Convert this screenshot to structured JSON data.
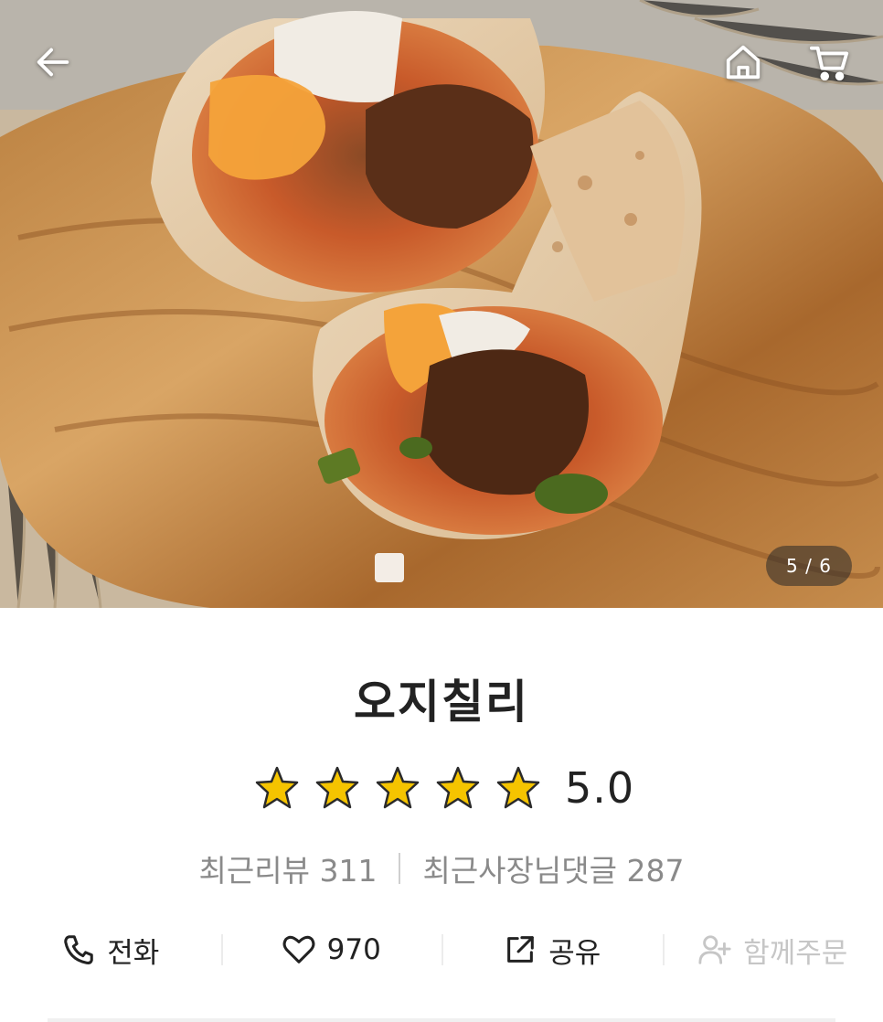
{
  "hero": {
    "image_alt": "오지칠리",
    "page_counter": "5 / 6"
  },
  "topbar": {
    "icons": [
      "back-arrow-icon",
      "home-icon",
      "cart-icon"
    ]
  },
  "store": {
    "name": "오지칠리",
    "rating": {
      "stars": 5,
      "max_stars": 5,
      "value": "5.0",
      "star_color": "#f5c400"
    },
    "reviews": {
      "recent_reviews_label": "최근리뷰 311",
      "owner_replies_label": "최근사장님댓글 287"
    }
  },
  "actions": {
    "call": {
      "label": "전화",
      "icon": "phone-icon"
    },
    "like": {
      "label": "970",
      "icon": "heart-icon"
    },
    "share": {
      "label": "공유",
      "icon": "share-icon"
    },
    "group_order": {
      "label": "함께주문",
      "icon": "add-person-icon",
      "disabled": true
    }
  }
}
